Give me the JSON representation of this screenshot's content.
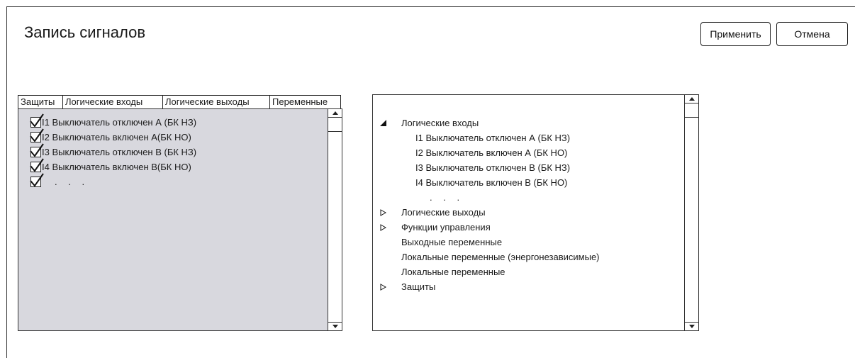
{
  "window": {
    "title": "Запись сигналов"
  },
  "toolbar": {
    "apply_label": "Применить",
    "cancel_label": "Отмена"
  },
  "tabs": [
    {
      "label": "Защиты"
    },
    {
      "label": "Логические входы"
    },
    {
      "label": "Логические выходы"
    },
    {
      "label": "Переменные"
    }
  ],
  "signal_list": {
    "items": [
      {
        "label": "I1 Выключатель отключен А (БК НЗ)",
        "checked": true
      },
      {
        "label": "I2 Выключатель включен А(БК НО)",
        "checked": true
      },
      {
        "label": "I3 Выключатель отключен В (БК НЗ)",
        "checked": true
      },
      {
        "label": "I4 Выключатель включен В(БК НО)",
        "checked": true
      }
    ],
    "more_item": {
      "label": ". . .",
      "checked": true
    }
  },
  "tree": {
    "nodes": [
      {
        "label": "Логические входы",
        "state": "expanded",
        "icon": "expanded-triangle-icon"
      },
      {
        "label": "I1 Выключатель отключен А (БК НЗ)",
        "level": 1
      },
      {
        "label": "I2 Выключатель включен А (БК НО)",
        "level": 1
      },
      {
        "label": "I3 Выключатель отключен В (БК НЗ)",
        "level": 1
      },
      {
        "label": "I4 Выключатель включен В (БК НО)",
        "level": 1
      },
      {
        "label": ". . .",
        "level": 1
      },
      {
        "label": "Логические выходы",
        "state": "collapsed",
        "icon": "collapsed-triangle-icon"
      },
      {
        "label": "Функции управления",
        "state": "collapsed",
        "icon": "collapsed-triangle-icon"
      },
      {
        "label": "Выходные переменные",
        "state": "leaf"
      },
      {
        "label": "Локальные переменные (энергонезависимые)",
        "state": "leaf"
      },
      {
        "label": "Локальные переменные",
        "state": "leaf"
      },
      {
        "label": "Защиты",
        "state": "collapsed",
        "icon": "collapsed-triangle-icon"
      }
    ]
  }
}
